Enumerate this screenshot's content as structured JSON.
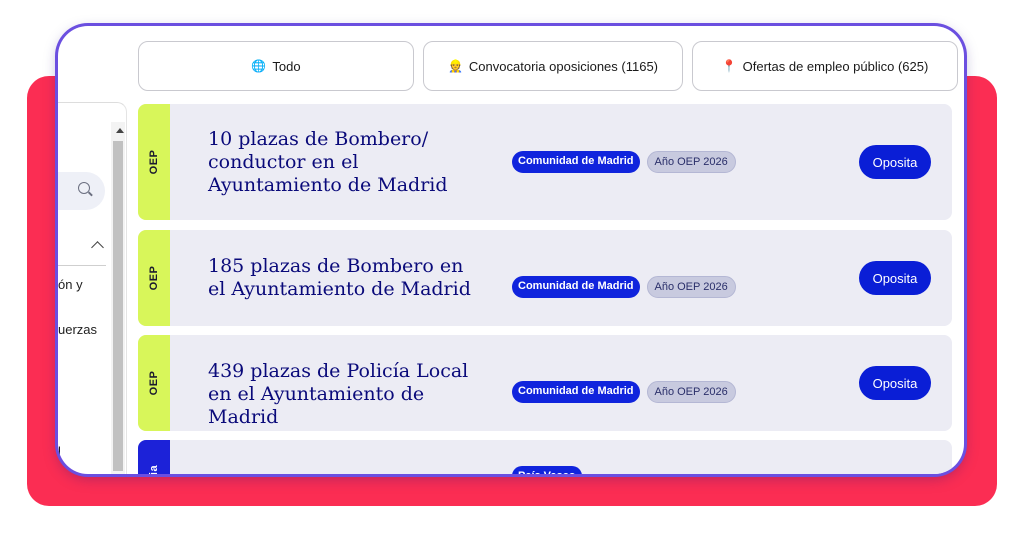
{
  "sidebar": {
    "text_a": "ón y",
    "text_b": "uerzas",
    "text_c": "l"
  },
  "tabs": [
    {
      "icon": "globe-icon",
      "label": "Todo"
    },
    {
      "icon": "person-icon",
      "label": "Convocatoria oposiciones (1165)"
    },
    {
      "icon": "pin-icon",
      "label": "Ofertas de empleo público (625)"
    }
  ],
  "cards": [
    {
      "type": "OEP",
      "title": "10 plazas de Bombero/ conductor en el Ayuntamiento de Madrid",
      "region": "Comunidad de Madrid",
      "year": "Año OEP 2026",
      "button": "Oposita"
    },
    {
      "type": "OEP",
      "title": "185 plazas de Bombero en el Ayuntamiento de Madrid",
      "region": "Comunidad de Madrid",
      "year": "Año OEP 2026",
      "button": "Oposita"
    },
    {
      "type": "OEP",
      "title": "439 plazas de Policía Local en el Ayuntamiento de Madrid",
      "region": "Comunidad de Madrid",
      "year": "Año OEP 2026",
      "button": "Oposita"
    },
    {
      "type": "ia",
      "region": "País Vasco"
    }
  ],
  "colors": {
    "backdrop": "#fb2d53",
    "oep_stripe": "#d8f65a",
    "accent_blue": "#0a1ed6",
    "title_color": "#0a0a7a"
  }
}
